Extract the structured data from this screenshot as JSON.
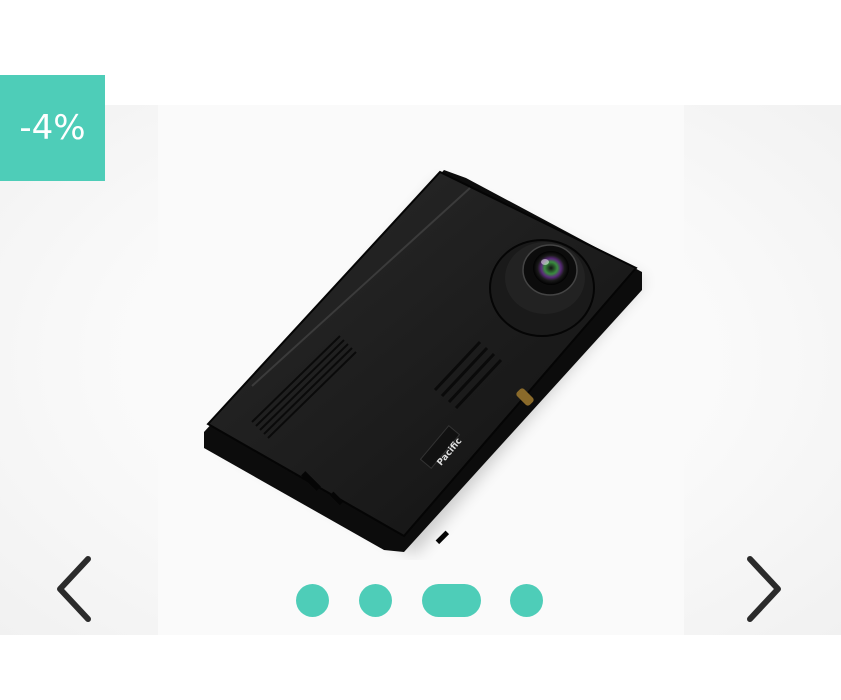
{
  "badge": {
    "discount_label": "-4%",
    "color": "#4ecdb8"
  },
  "gallery": {
    "image_icon": "dashcam-product-photo",
    "product_brand_text": "Pacific",
    "prev_icon": "chevron-left-icon",
    "next_icon": "chevron-right-icon",
    "slide_count": 4,
    "active_slide": 3,
    "dot_color": "#4ecdb8"
  }
}
